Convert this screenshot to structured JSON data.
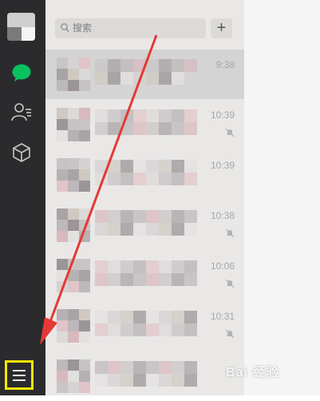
{
  "search": {
    "placeholder": "搜索"
  },
  "add_button_label": "+",
  "chats": [
    {
      "time": "9:38",
      "muted": false,
      "selected": true
    },
    {
      "time": "10:39",
      "muted": true,
      "selected": false
    },
    {
      "time": "10:39",
      "muted": false,
      "selected": false
    },
    {
      "time": "10:38",
      "muted": true,
      "selected": false
    },
    {
      "time": "10:06",
      "muted": true,
      "selected": false
    },
    {
      "time": "10:31",
      "muted": true,
      "selected": false
    },
    {
      "time": "",
      "muted": false,
      "selected": false
    }
  ],
  "watermark": "Bai 经验",
  "colors": {
    "sidebar": "#2b2b2d",
    "chat_icon_active": "#07c160",
    "highlight_box": "#f5e800",
    "arrow": "#e53935"
  },
  "icons": [
    "chat-icon",
    "contacts-icon",
    "favorites-icon",
    "menu-icon",
    "search-icon",
    "mute-bell-icon"
  ]
}
